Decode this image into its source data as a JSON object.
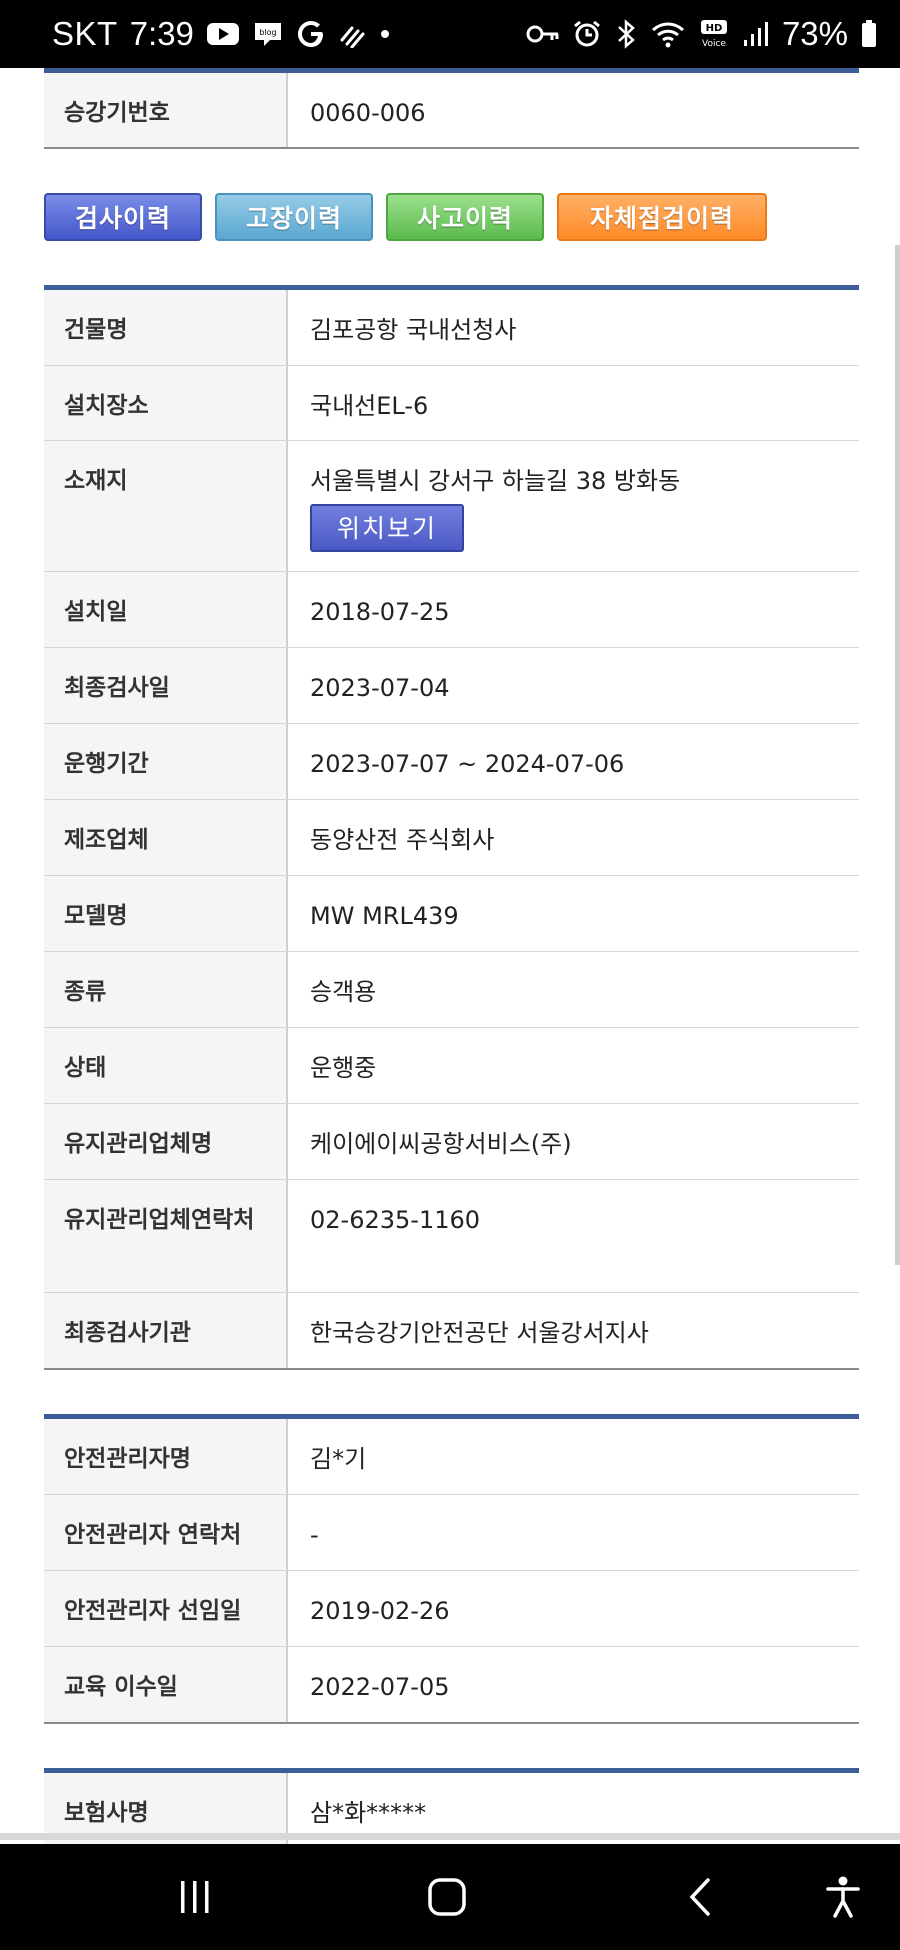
{
  "status_bar": {
    "carrier": "SKT",
    "time": "7:39",
    "battery": "73%",
    "icons_left": [
      "youtube-icon",
      "blog-icon",
      "google-icon",
      "signal-app-icon",
      "dot-icon"
    ],
    "icons_right": [
      "key-icon",
      "alarm-icon",
      "bluetooth-icon",
      "wifi-icon",
      "hd-voice-icon",
      "signal-bars-icon",
      "battery-icon"
    ]
  },
  "top_table": {
    "rows": [
      {
        "label": "승강기번호",
        "value": "0060-006"
      }
    ]
  },
  "history_buttons": {
    "inspection": "검사이력",
    "failure": "고장이력",
    "accident": "사고이력",
    "self_check": "자체점검이력"
  },
  "info_table": {
    "building_label": "건물명",
    "building": "김포공항 국내선청사",
    "location_label": "설치장소",
    "location": "국내선EL-6",
    "address_label": "소재지",
    "address": "서울특별시 강서구 하늘길 38 방화동",
    "map_button": "위치보기",
    "install_date_label": "설치일",
    "install_date": "2018-07-25",
    "last_inspection_label": "최종검사일",
    "last_inspection": "2023-07-04",
    "operation_period_label": "운행기간",
    "operation_period": "2023-07-07 ~ 2024-07-06",
    "manufacturer_label": "제조업체",
    "manufacturer": "동양산전 주식회사",
    "model_label": "모델명",
    "model": "MW MRL439",
    "type_label": "종류",
    "type": "승객용",
    "status_label": "상태",
    "status": "운행중",
    "maintenance_company_label": "유지관리업체명",
    "maintenance_company": "케이에이씨공항서비스(주)",
    "maintenance_contact_label": "유지관리업체연락처",
    "maintenance_contact": "02-6235-1160",
    "inspection_agency_label": "최종검사기관",
    "inspection_agency": "한국승강기안전공단 서울강서지사"
  },
  "safety_table": {
    "manager_label": "안전관리자명",
    "manager": "김*기",
    "manager_contact_label": "안전관리자 연락처",
    "manager_contact": "-",
    "appointed_label": "안전관리자 선임일",
    "appointed": "2019-02-26",
    "training_label": "교육 이수일",
    "training": "2022-07-05"
  },
  "insurance_table": {
    "insurer_label": "보험사명",
    "insurer": "삼*화*****"
  },
  "nav": {
    "icons": [
      "recent-apps-icon",
      "home-icon",
      "back-icon",
      "accessibility-icon"
    ]
  }
}
